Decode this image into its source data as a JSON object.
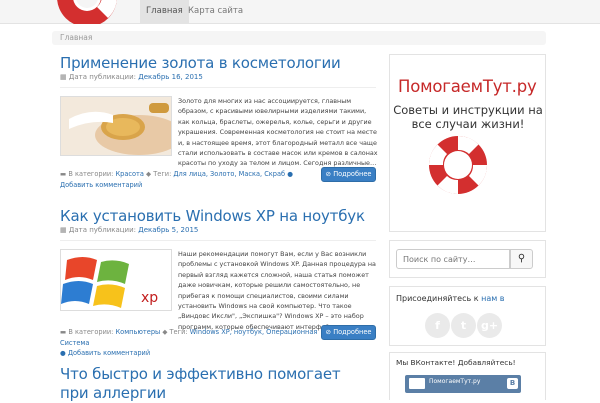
{
  "nav": {
    "items": [
      {
        "label": "Главная",
        "active": true
      },
      {
        "label": "Карта сайта",
        "active": false
      }
    ]
  },
  "breadcrumb": "Главная",
  "posts": [
    {
      "title": "Применение золота в косметологии",
      "date_label": "Дата публикации:",
      "date": "Декабрь 16, 2015",
      "excerpt": "Золото для многих из нас ассоциируется, главным образом, с красивыми ювелирными изделиями такими, как кольца, браслеты, ожерелья, колье, серьги и другие украшения. Современная косметология не стоит на месте и, в настоящее время, этот благородный металл все чаще стали использовать в составе масок или кремов в салонах красоты по уходу за телом и лицом. Сегодня различные…",
      "cat_label": "В категории:",
      "category": "Красота",
      "tags_label": "Теги:",
      "tags": "Для лица, Золото, Маска, Скраб",
      "comments": "Добавить комментарий",
      "more": "Подробнее"
    },
    {
      "title": "Как установить Windows XP на ноутбук",
      "date_label": "Дата публикации:",
      "date": "Декабрь 5, 2015",
      "excerpt": "Наши рекомендации помогут Вам, если у Вас возникли проблемы с установкой Windows XP. Данная процедура на первый взгляд кажется сложной, наша статья поможет даже новичкам, которые решили самостоятельно, не прибегая к помощи специалистов, своими силами установить Windows на свой компьютер. Что такое „Виндовс Иксли\", „Экспишка\"? Windows XP – это набор программ, которые обеспечивают интерфейс между…",
      "cat_label": "В категории:",
      "category": "Компьютеры",
      "tags_label": "Теги:",
      "tags": "Windows XP, ноутбук, Операционная Система",
      "comments": "Добавить комментарий",
      "more": "Подробнее"
    },
    {
      "title": "Что быстро и эффективно помогает при аллергии"
    }
  ],
  "sidebar": {
    "brand": "ПомогаемТут.ру",
    "tagline": "Советы и инструкции на все случаи жизни!",
    "search_placeholder": "Поиск по сайту…",
    "join_prefix": "Присоединяйтесь к ",
    "join_link": "нам в",
    "vk_title": "Мы ВКонтакте! Добавляйтесь!",
    "vk_widget_label": "ПомогаемТут.ру",
    "vk_logo": "B"
  },
  "icons": [
    "lifebuoy-icon",
    "calendar-icon",
    "folder-icon",
    "tag-icon",
    "comment-icon",
    "link-icon",
    "search-icon",
    "facebook-icon",
    "twitter-icon",
    "googleplus-icon"
  ],
  "colors": {
    "link": "#2a6fb0",
    "brand_red": "#c62828",
    "button": "#3a7fc4",
    "vk": "#5b7fa6"
  }
}
